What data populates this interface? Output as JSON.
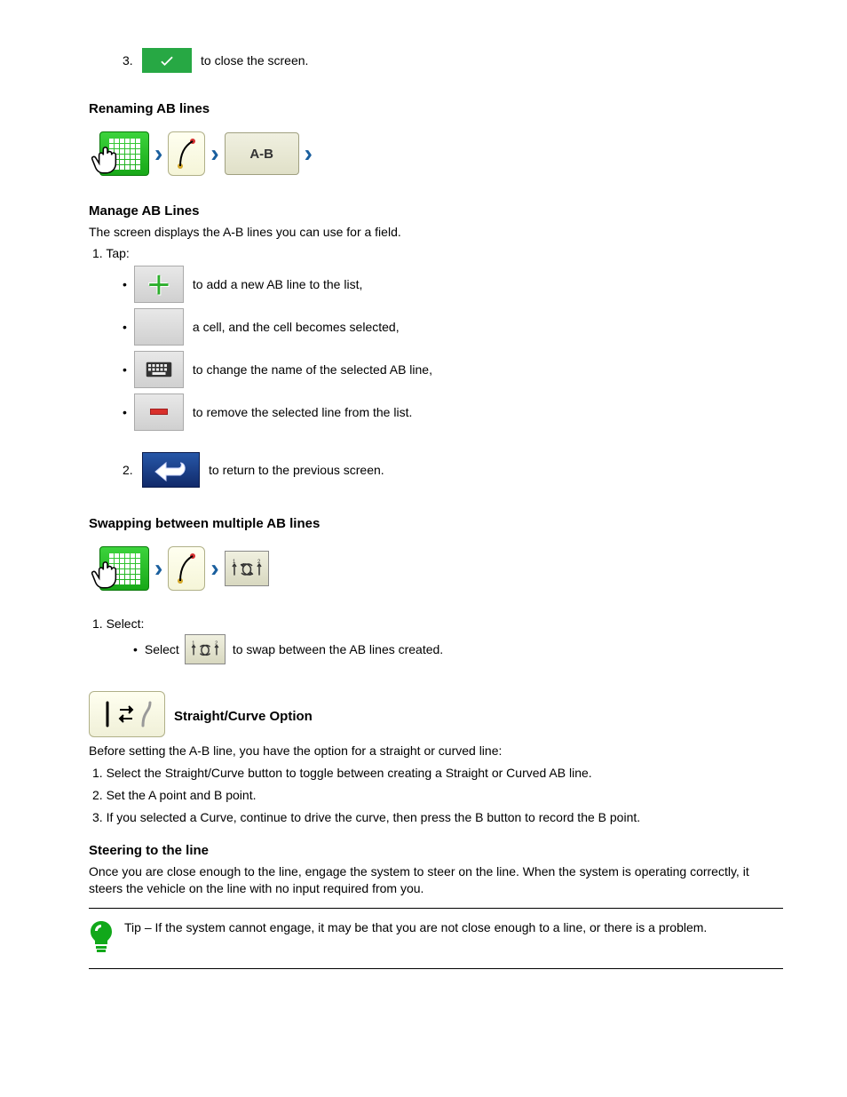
{
  "step3_prefix": "3.",
  "check_label": "Check",
  "step3_text": "to close the screen.",
  "renaming_title": "Renaming AB lines",
  "manage_lines_title": "Manage AB Lines",
  "manage_lines_intro": "The screen displays the A-B lines you can use for a field.",
  "add_new_text": "to add a new AB line to the list,",
  "empty_cell_text": "a cell, and the cell becomes selected,",
  "keyboard_text": "to change the name of the selected AB line,",
  "remove_text": "to remove the selected line from the list.",
  "step2_prefix": "2.",
  "back_text": "to return to the previous screen.",
  "swapping_title": "Swapping between multiple AB lines",
  "swap_prefix": "Select",
  "swap_text": "to swap between the AB lines created.",
  "straight_curve_title": "Straight/Curve Option",
  "straight_curve_intro": "Before setting the A-B line, you have the option for a straight or curved line:",
  "sc1": "1. Select the Straight/Curve button to toggle between creating a Straight or Curved AB line.",
  "sc2": "2. Set the A point and B point.",
  "sc3": "3. If you selected a Curve, continue to drive the curve, then press the B button to record the B point.",
  "steering_title": "Steering to the line",
  "steering_text": "Once you are close enough to the line, engage the system to steer on the line. When the system is operating correctly, it steers the vehicle on the line with no input required from you.",
  "tip_text": "Tip – If the system cannot engage, it may be that you are not close enough to a line, or there is a problem.",
  "step1_tap_prefix": "1. Tap:",
  "step1_select_prefix": "1. Select:",
  "ab_label": "A-B"
}
